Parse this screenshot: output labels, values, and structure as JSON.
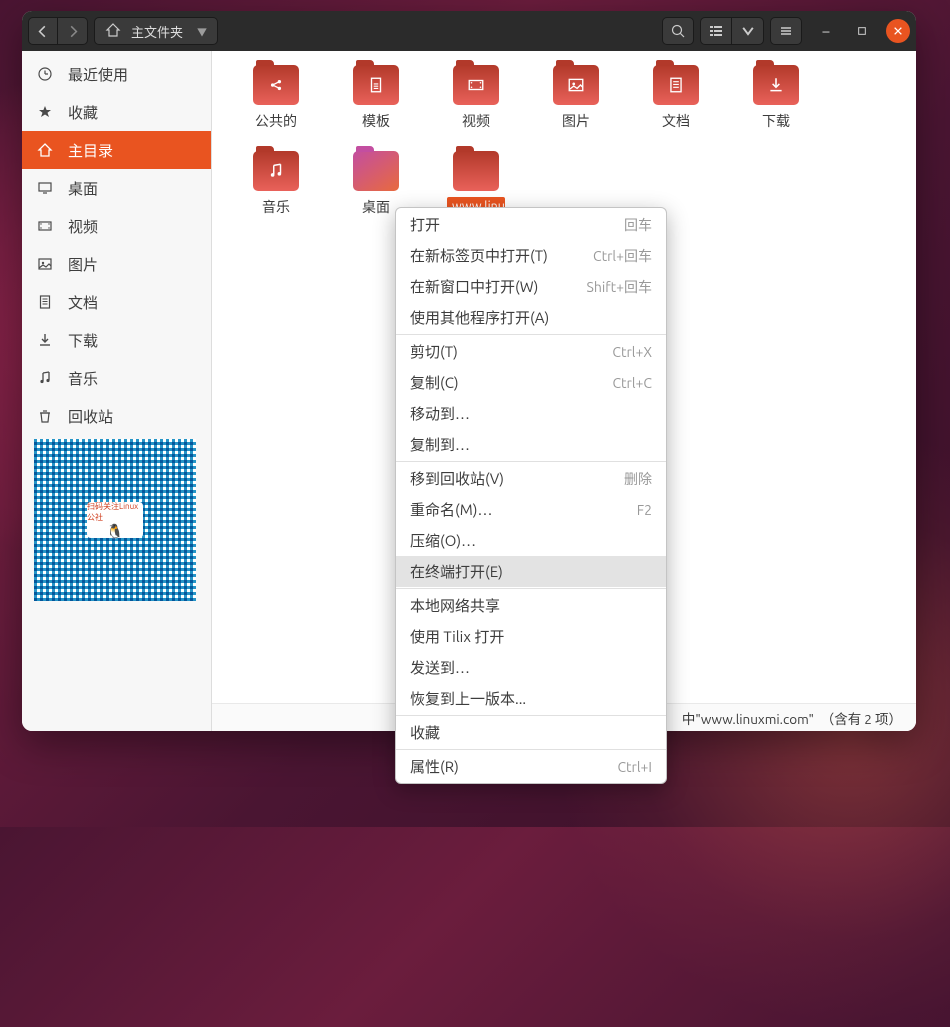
{
  "titlebar": {
    "path_label": "主文件夹"
  },
  "sidebar": {
    "items": [
      {
        "label": "最近使用",
        "icon": "clock"
      },
      {
        "label": "收藏",
        "icon": "star"
      },
      {
        "label": "主目录",
        "icon": "home",
        "active": true
      },
      {
        "label": "桌面",
        "icon": "desktop"
      },
      {
        "label": "视频",
        "icon": "video"
      },
      {
        "label": "图片",
        "icon": "image"
      },
      {
        "label": "文档",
        "icon": "document"
      },
      {
        "label": "下载",
        "icon": "download"
      },
      {
        "label": "音乐",
        "icon": "music"
      },
      {
        "label": "回收站",
        "icon": "trash"
      }
    ],
    "qr_label": "扫码关注Linux公社"
  },
  "folders": [
    {
      "label": "公共的",
      "icon": "share"
    },
    {
      "label": "模板",
      "icon": "template"
    },
    {
      "label": "视频",
      "icon": "video"
    },
    {
      "label": "图片",
      "icon": "image"
    },
    {
      "label": "文档",
      "icon": "document"
    },
    {
      "label": "下载",
      "icon": "download"
    },
    {
      "label": "音乐",
      "icon": "music"
    },
    {
      "label": "桌面",
      "icon": "desktop"
    },
    {
      "label": "www.linuxmi.com",
      "icon": "folder",
      "selected": true
    }
  ],
  "statusbar": {
    "text": "中\"www.linuxmi.com\"　（含有 2 项）"
  },
  "contextmenu": {
    "items": [
      {
        "label": "打开",
        "accel": "回车"
      },
      {
        "label": "在新标签页中打开(T)",
        "accel": "Ctrl+回车"
      },
      {
        "label": "在新窗口中打开(W)",
        "accel": "Shift+回车"
      },
      {
        "label": "使用其他程序打开(A)"
      },
      {
        "sep": true
      },
      {
        "label": "剪切(T)",
        "accel": "Ctrl+X"
      },
      {
        "label": "复制(C)",
        "accel": "Ctrl+C"
      },
      {
        "label": "移动到…"
      },
      {
        "label": "复制到…"
      },
      {
        "sep": true
      },
      {
        "label": "移到回收站(V)",
        "accel": "删除"
      },
      {
        "label": "重命名(M)…",
        "accel": "F2"
      },
      {
        "label": "压缩(O)…"
      },
      {
        "label": "在终端打开(E)",
        "hover": true
      },
      {
        "sep": true
      },
      {
        "label": "本地网络共享"
      },
      {
        "label": "使用 Tilix 打开"
      },
      {
        "label": "发送到…"
      },
      {
        "label": "恢复到上一版本..."
      },
      {
        "sep": true
      },
      {
        "label": "收藏"
      },
      {
        "sep": true
      },
      {
        "label": "属性(R)",
        "accel": "Ctrl+I"
      }
    ]
  }
}
